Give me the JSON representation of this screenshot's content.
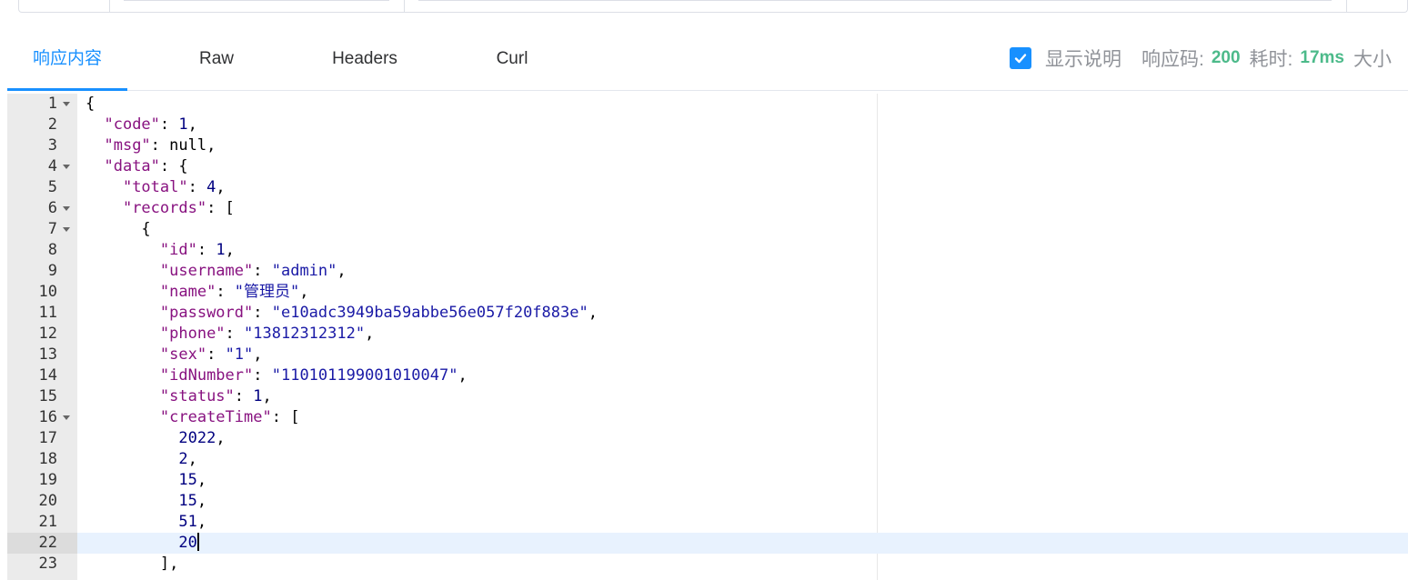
{
  "tabs": [
    {
      "label": "响应内容",
      "active": true
    },
    {
      "label": "Raw",
      "active": false
    },
    {
      "label": "Headers",
      "active": false
    },
    {
      "label": "Curl",
      "active": false
    }
  ],
  "info": {
    "show_desc_checked": true,
    "show_desc_label": "显示说明",
    "code_label": "响应码:",
    "code_value": "200",
    "time_label": "耗时:",
    "time_value": "17ms",
    "size_label": "大小"
  },
  "colors": {
    "accent": "#1890ff",
    "success": "#4cba8a"
  },
  "editor": {
    "cursor_line": 22,
    "lines": [
      {
        "n": "1",
        "fold": true
      },
      {
        "n": "2",
        "fold": false
      },
      {
        "n": "3",
        "fold": false
      },
      {
        "n": "4",
        "fold": true
      },
      {
        "n": "5",
        "fold": false
      },
      {
        "n": "6",
        "fold": true
      },
      {
        "n": "7",
        "fold": true
      },
      {
        "n": "8",
        "fold": false
      },
      {
        "n": "9",
        "fold": false
      },
      {
        "n": "10",
        "fold": false
      },
      {
        "n": "11",
        "fold": false
      },
      {
        "n": "12",
        "fold": false
      },
      {
        "n": "13",
        "fold": false
      },
      {
        "n": "14",
        "fold": false
      },
      {
        "n": "15",
        "fold": false
      },
      {
        "n": "16",
        "fold": true
      },
      {
        "n": "17",
        "fold": false
      },
      {
        "n": "18",
        "fold": false
      },
      {
        "n": "19",
        "fold": false
      },
      {
        "n": "20",
        "fold": false
      },
      {
        "n": "21",
        "fold": false
      },
      {
        "n": "22",
        "fold": false
      },
      {
        "n": "23",
        "fold": false
      }
    ],
    "code": {
      "l1": {
        "p": "{"
      },
      "l2": {
        "k": "\"code\"",
        "c": ": ",
        "v": "1",
        "e": ","
      },
      "l3": {
        "k": "\"msg\"",
        "c": ": ",
        "v": "null",
        "e": ","
      },
      "l4": {
        "k": "\"data\"",
        "c": ": {"
      },
      "l5": {
        "k": "\"total\"",
        "c": ": ",
        "v": "4",
        "e": ","
      },
      "l6": {
        "k": "\"records\"",
        "c": ": ["
      },
      "l7": {
        "p": "{"
      },
      "l8": {
        "k": "\"id\"",
        "c": ": ",
        "v": "1",
        "e": ","
      },
      "l9": {
        "k": "\"username\"",
        "c": ": ",
        "v": "\"admin\"",
        "e": ","
      },
      "l10": {
        "k": "\"name\"",
        "c": ": ",
        "v": "\"管理员\"",
        "e": ","
      },
      "l11": {
        "k": "\"password\"",
        "c": ": ",
        "v": "\"e10adc3949ba59abbe56e057f20f883e\"",
        "e": ","
      },
      "l12": {
        "k": "\"phone\"",
        "c": ": ",
        "v": "\"13812312312\"",
        "e": ","
      },
      "l13": {
        "k": "\"sex\"",
        "c": ": ",
        "v": "\"1\"",
        "e": ","
      },
      "l14": {
        "k": "\"idNumber\"",
        "c": ": ",
        "v": "\"110101199001010047\"",
        "e": ","
      },
      "l15": {
        "k": "\"status\"",
        "c": ": ",
        "v": "1",
        "e": ","
      },
      "l16": {
        "k": "\"createTime\"",
        "c": ": ["
      },
      "l17": {
        "v": "2022",
        "e": ","
      },
      "l18": {
        "v": "2",
        "e": ","
      },
      "l19": {
        "v": "15",
        "e": ","
      },
      "l20": {
        "v": "15",
        "e": ","
      },
      "l21": {
        "v": "51",
        "e": ","
      },
      "l22": {
        "v": "20"
      },
      "l23": {
        "p": "],"
      }
    }
  }
}
